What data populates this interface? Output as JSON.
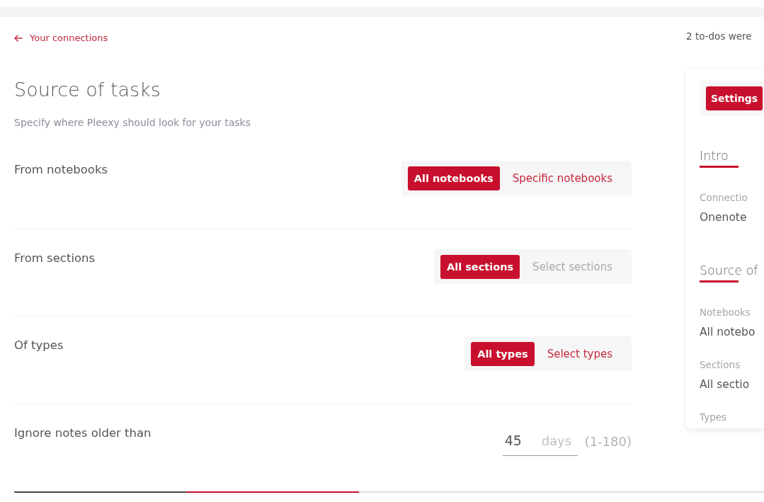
{
  "back_link": {
    "label": "Your connections"
  },
  "sync_notice": "2 to-dos were",
  "header": {
    "title": "Source of tasks",
    "subtitle": "Specify where Pleexy should look for your tasks"
  },
  "settings": [
    {
      "kind": "segmented",
      "label": "From notebooks",
      "options": [
        {
          "label": "All notebooks",
          "selected": true,
          "disabled": false
        },
        {
          "label": "Specific notebooks",
          "selected": false,
          "disabled": false
        }
      ]
    },
    {
      "kind": "segmented",
      "label": "From sections",
      "options": [
        {
          "label": "All sections",
          "selected": true,
          "disabled": false
        },
        {
          "label": "Select sections",
          "selected": false,
          "disabled": true
        }
      ]
    },
    {
      "kind": "segmented",
      "label": "Of types",
      "options": [
        {
          "label": "All types",
          "selected": true,
          "disabled": false
        },
        {
          "label": "Select types",
          "selected": false,
          "disabled": false
        }
      ]
    },
    {
      "kind": "number",
      "label": "Ignore notes older than",
      "value": "45",
      "unit": "days",
      "range": "(1-180)"
    }
  ],
  "progress": {
    "level": 0.46
  },
  "summary_panel": {
    "tabs": [
      {
        "label": "Settings",
        "selected": true
      }
    ],
    "sections": [
      {
        "title": "Intro",
        "fields": [
          {
            "label": "Connectio",
            "value": "Onenote"
          }
        ]
      },
      {
        "title": "Source of",
        "fields": [
          {
            "label": "Notebooks",
            "value": "All notebo"
          },
          {
            "label": "Sections",
            "value": "All sectio"
          },
          {
            "label": "Types"
          }
        ]
      }
    ]
  }
}
